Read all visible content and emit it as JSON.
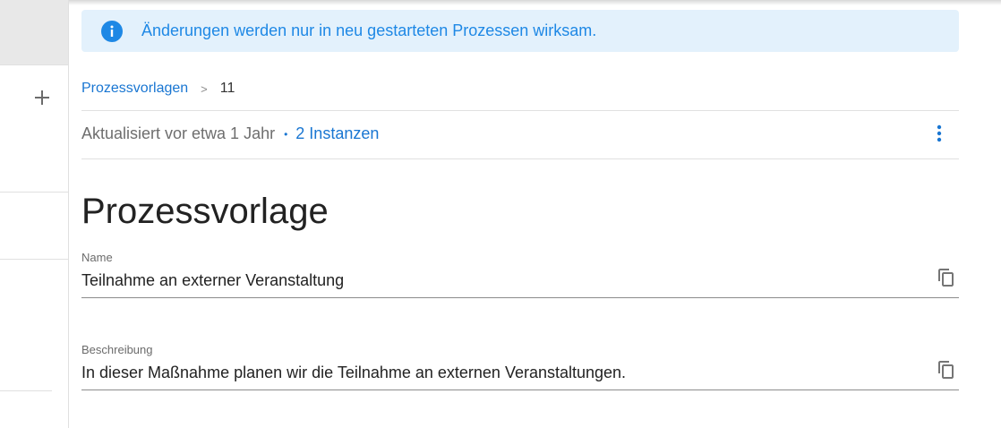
{
  "banner": {
    "icon": "info-icon",
    "text": "Änderungen werden nur in neu gestarteten Prozessen wirksam.",
    "color": "#1e88e5",
    "background": "#e3f1fc"
  },
  "sidebar": {
    "add_icon": "plus-icon"
  },
  "breadcrumb": {
    "parent": "Prozessvorlagen",
    "separator": ">",
    "current": "11"
  },
  "meta": {
    "updated": "Aktualisiert vor etwa 1 Jahr",
    "dot": "•",
    "instances": "2 Instanzen",
    "menu_icon": "more-vert-icon"
  },
  "page": {
    "title": "Prozessvorlage"
  },
  "fields": {
    "name": {
      "label": "Name",
      "value": "Teilnahme an externer Veranstaltung",
      "copy_icon": "copy-icon"
    },
    "description": {
      "label": "Beschreibung",
      "value": "In dieser Maßnahme planen wir die Teilnahme an externen Veranstaltungen.",
      "copy_icon": "copy-icon"
    }
  },
  "colors": {
    "accent": "#1976d2",
    "divider": "#e0e0e0"
  }
}
